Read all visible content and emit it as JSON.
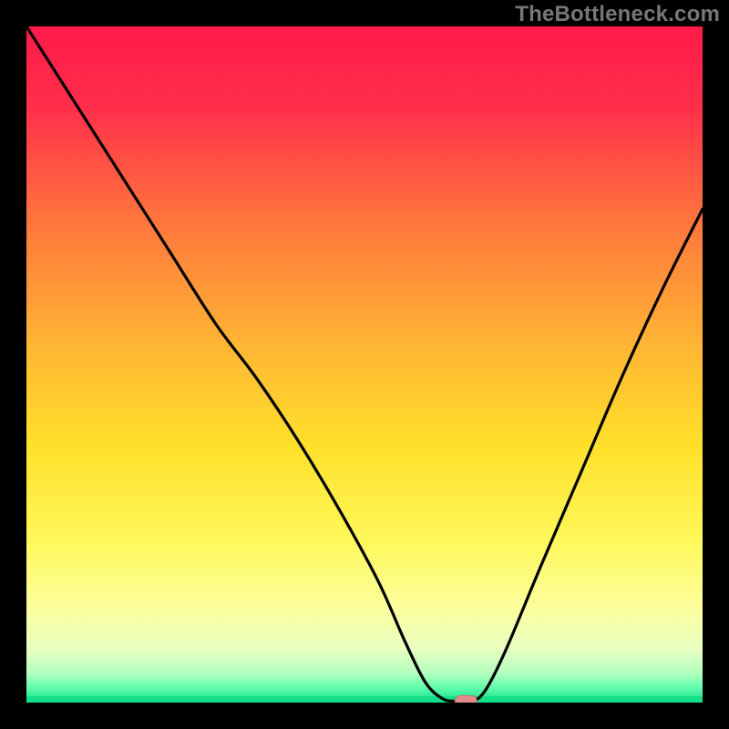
{
  "watermark": "TheBottleneck.com",
  "colors": {
    "bg_black": "#000000",
    "curve": "#000000",
    "marker_fill": "#e58a8a",
    "marker_stroke": "#c77070",
    "gradient_stops": [
      {
        "offset": 0.0,
        "color": "#ff1a4a"
      },
      {
        "offset": 0.12,
        "color": "#ff2f4a"
      },
      {
        "offset": 0.3,
        "color": "#ff7a3c"
      },
      {
        "offset": 0.48,
        "color": "#ffb833"
      },
      {
        "offset": 0.62,
        "color": "#ffe02a"
      },
      {
        "offset": 0.76,
        "color": "#fff85a"
      },
      {
        "offset": 0.86,
        "color": "#fdff9e"
      },
      {
        "offset": 0.92,
        "color": "#e9ffc0"
      },
      {
        "offset": 0.955,
        "color": "#b7ffc0"
      },
      {
        "offset": 0.975,
        "color": "#6bffb0"
      },
      {
        "offset": 1.0,
        "color": "#14e08a"
      }
    ],
    "baseline_green": "#12df88"
  },
  "chart_data": {
    "type": "line",
    "title": "",
    "xlabel": "",
    "ylabel": "",
    "xlim": [
      0,
      100
    ],
    "ylim": [
      0,
      100
    ],
    "grid": false,
    "legend": false,
    "series": [
      {
        "name": "bottleneck-curve",
        "x": [
          0,
          7,
          14,
          21,
          28,
          34,
          40,
          46,
          52,
          56,
          59,
          61.5,
          63.5,
          66,
          68,
          71,
          76,
          82,
          88,
          94,
          100
        ],
        "y": [
          100,
          89,
          78,
          67,
          56,
          48,
          39,
          29,
          18,
          9,
          3,
          0.6,
          0.2,
          0.2,
          2,
          8,
          20,
          34,
          48,
          61,
          73
        ]
      }
    ],
    "flat_bottom": {
      "x_start": 61.5,
      "x_end": 66,
      "y": 0.1
    },
    "marker": {
      "x": 65,
      "y": 0.2,
      "shape": "pill"
    },
    "annotations": []
  }
}
